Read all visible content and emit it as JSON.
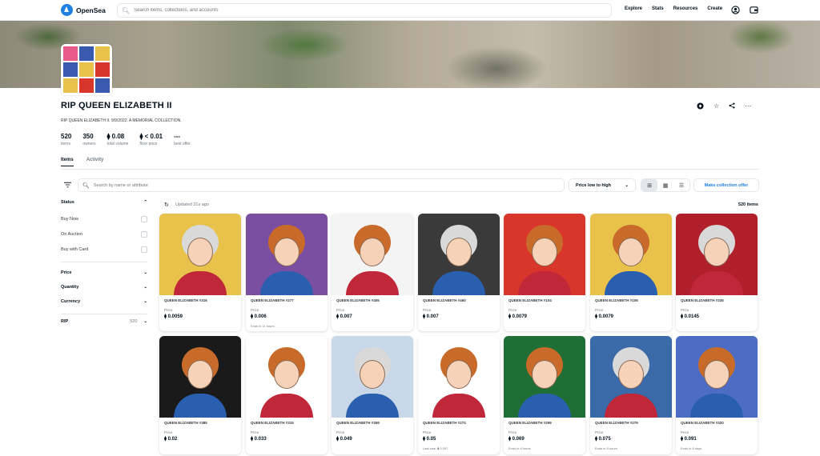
{
  "nav": {
    "logo_text": "OpenSea",
    "search_placeholder": "Search items, collections, and accounts",
    "links": [
      "Explore",
      "Stats",
      "Resources",
      "Create"
    ]
  },
  "collection": {
    "title": "RIP QUEEN ELIZABETH II",
    "description": "RIP QUEEN ELIZABETH II. 9/9/2022. A MEMORIAL COLLECTION.",
    "stats": [
      {
        "value": "520",
        "label": "items"
      },
      {
        "value": "350",
        "label": "owners"
      },
      {
        "value": "⧫ 0.08",
        "label": "total volume"
      },
      {
        "value": "⧫ < 0.01",
        "label": "floor price"
      },
      {
        "value": "---",
        "label": "best offer"
      }
    ]
  },
  "tabs": [
    "Items",
    "Activity"
  ],
  "toolbar": {
    "search_placeholder": "Search by name or attribute",
    "sort_label": "Price low to high",
    "offer_button": "Make collection offer"
  },
  "sidebar": {
    "status_label": "Status",
    "status_options": [
      "Buy Now",
      "On Auction",
      "Buy with Card"
    ],
    "sections": [
      "Price",
      "Quantity",
      "Currency"
    ],
    "trait": {
      "name": "RIP",
      "count": "520"
    }
  },
  "grid": {
    "updated": "Updated 31s ago",
    "count": "520 items",
    "price_label": "Price",
    "items": [
      {
        "name": "QUEEN ELIZABETH #316",
        "price": "0.0059",
        "note": ""
      },
      {
        "name": "QUEEN ELIZABETH #277",
        "price": "0.006",
        "note": "Ends in 11 hours"
      },
      {
        "name": "QUEEN ELIZABETH #455",
        "price": "0.007",
        "note": ""
      },
      {
        "name": "QUEEN ELIZABETH #460",
        "price": "0.007",
        "note": ""
      },
      {
        "name": "QUEEN ELIZABETH #104",
        "price": "0.0079",
        "note": ""
      },
      {
        "name": "QUEEN ELIZABETH #106",
        "price": "0.0079",
        "note": ""
      },
      {
        "name": "QUEEN ELIZABETH #335",
        "price": "0.0145",
        "note": ""
      },
      {
        "name": "QUEEN ELIZABETH #385",
        "price": "0.02",
        "note": ""
      },
      {
        "name": "QUEEN ELIZABETH #315",
        "price": "0.033",
        "note": ""
      },
      {
        "name": "QUEEN ELIZABETH #359",
        "price": "0.049",
        "note": ""
      },
      {
        "name": "QUEEN ELIZABETH #274",
        "price": "0.05",
        "note": "Last sale: ⧫ 0.007"
      },
      {
        "name": "QUEEN ELIZABETH #299",
        "price": "0.069",
        "note": "Ends in 8 hours"
      },
      {
        "name": "QUEEN ELIZABETH #279",
        "price": "0.075",
        "note": "Ends in 8 hours"
      },
      {
        "name": "QUEEN ELIZABETH #320",
        "price": "0.091",
        "note": "Ends in 8 days"
      }
    ]
  },
  "art_colors": {
    "row1": [
      "#e8c24a",
      "#7a4ea0",
      "#f4f4f4",
      "#3a3a3a",
      "#d8362b",
      "#e8c24a",
      "#b0202a"
    ],
    "row2": [
      "#1a1a1a",
      "#ffffff",
      "#c8d8e8",
      "#ffffff",
      "#1f6e36",
      "#3a6aa8",
      "#4d6cc4"
    ]
  },
  "colors": {
    "accent": "#2081e2",
    "text": "#04111d",
    "muted": "#707a83"
  },
  "icons": [
    "search-icon",
    "account-icon",
    "wallet-icon",
    "share-icon",
    "star-icon",
    "more-icon",
    "filter-icon",
    "refresh-icon",
    "chevron-down-icon",
    "grid-large-icon",
    "grid-small-icon",
    "list-icon"
  ]
}
